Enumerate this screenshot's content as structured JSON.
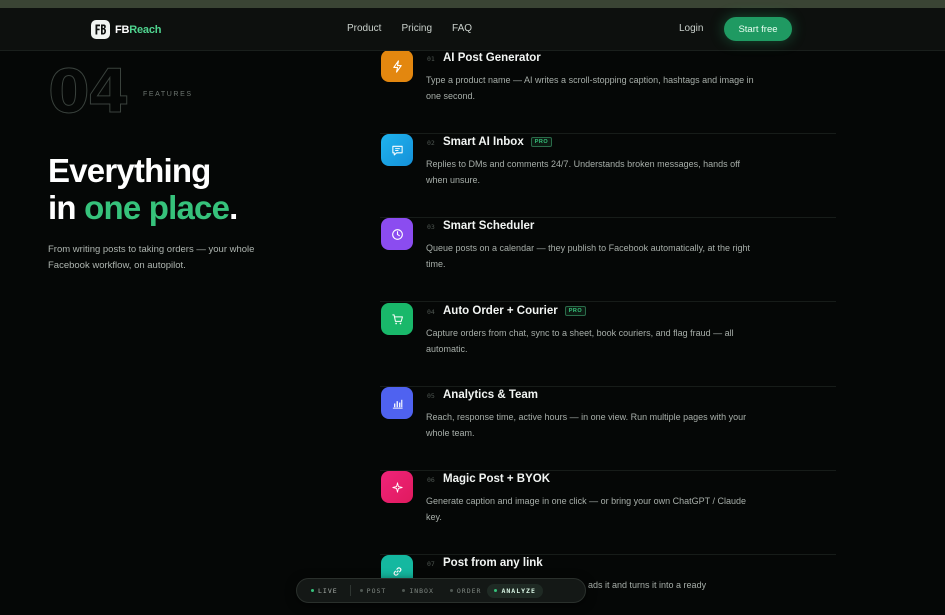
{
  "nav": {
    "logo_fb": "FB",
    "logo_reach": "Reach",
    "links": [
      "Product",
      "Pricing",
      "FAQ"
    ],
    "login": "Login",
    "cta": "Start free"
  },
  "hero": {
    "section_number": "04",
    "section_label": "FEATURES",
    "headline_line1": "Everything",
    "headline_in": "in ",
    "headline_accent": "one place",
    "headline_period": ".",
    "subtext": "From writing posts to taking orders — your whole Facebook workflow, on autopilot."
  },
  "features": [
    {
      "num": "01",
      "title": "AI Post Generator",
      "badge": "",
      "desc": "Type a product name — AI writes a scroll-stopping caption, hashtags and image in one second.",
      "icon": "lightning-icon",
      "color": "#e3870f"
    },
    {
      "num": "02",
      "title": "Smart AI Inbox",
      "badge": "PRO",
      "desc": "Replies to DMs and comments 24/7. Understands broken messages, hands off when unsure.",
      "icon": "chat-icon",
      "color": "#1aa6e6"
    },
    {
      "num": "03",
      "title": "Smart Scheduler",
      "badge": "",
      "desc": "Queue posts on a calendar — they publish to Facebook automatically, at the right time.",
      "icon": "clock-icon",
      "color": "#8b4cf0"
    },
    {
      "num": "04",
      "title": "Auto Order + Courier",
      "badge": "PRO",
      "desc": "Capture orders from chat, sync to a sheet, book couriers, and flag fraud — all automatic.",
      "icon": "cart-icon",
      "color": "#19b86a"
    },
    {
      "num": "05",
      "title": "Analytics & Team",
      "badge": "",
      "desc": "Reach, response time, active hours — in one view. Run multiple pages with your whole team.",
      "icon": "bar-chart-icon",
      "color": "#4f62f0"
    },
    {
      "num": "06",
      "title": "Magic Post + BYOK",
      "badge": "",
      "desc": "Generate caption and image in one click — or bring your own ChatGPT / Claude key.",
      "icon": "sparkle-icon",
      "color": "#ec1f6f"
    },
    {
      "num": "07",
      "title": "Post from any link",
      "badge": "",
      "desc": "ads it and turns it into a ready",
      "icon": "link-icon",
      "color": "#14b8a0"
    }
  ],
  "bottom_bar": {
    "live": "LIVE",
    "items": [
      "POST",
      "INBOX",
      "ORDER",
      "ANALYZE"
    ],
    "active": "ANALYZE"
  }
}
